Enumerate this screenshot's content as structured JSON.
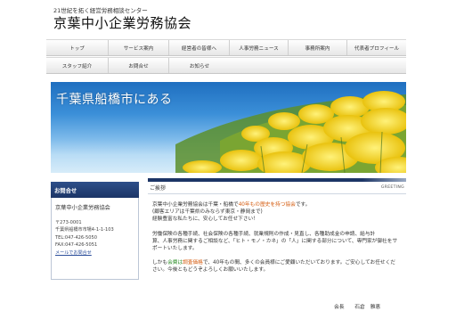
{
  "header": {
    "tagline": "21世紀を拓く経営労務相談センター",
    "title": "京葉中小企業労務協会"
  },
  "nav": {
    "row1": [
      {
        "label": "トップ"
      },
      {
        "label": "サービス案内"
      },
      {
        "label": "経営者の皆様へ"
      },
      {
        "label": "人事労務ニュース"
      },
      {
        "label": "事務所案内"
      },
      {
        "label": "代表者プロフィール"
      }
    ],
    "row2": [
      {
        "label": "スタッフ紹介"
      },
      {
        "label": "お問合せ"
      },
      {
        "label": "お知らせ"
      }
    ]
  },
  "hero": {
    "text": "千葉県船橋市にある"
  },
  "sidebar": {
    "heading": "お問合せ",
    "org": "京葉中小企業労務協会",
    "postal": "〒273-0001",
    "address": "千葉県船橋市市場4-1-1-103",
    "tel": "TEL:047-426-5050",
    "fax": "FAX:047-426-5051",
    "mail_link": "メールでお問合せ"
  },
  "main": {
    "title": "ご挨拶",
    "label": "GREETING",
    "p1_a": "京葉中小企業労務協会は千葉・船橋で",
    "p1_highlight": "40年もの歴史を持つ協会",
    "p1_b": "です。",
    "p1_line2": "(顧客エリアは千葉県のみならず東京・静岡まで)",
    "p1_line3": "経験豊富な私たちに、安心してお任せ下さい！",
    "p2_line1": "労働保険の各種手続、社会保険の各種手続、就業規則の作成・見直し、各種助成金の申請、給与計",
    "p2_line2": "算、人事労務に関するご相談など、「ヒト・モノ・カネ」の「人」に関する部分について、専門家が御社をサ",
    "p2_line3": "ポートいたします。",
    "p3_a": "しかも",
    "p3_highlight1": "会費は",
    "p3_highlight2": "調査価格",
    "p3_b": "で、40年もの間、多くの会員様にご愛顧いただいております。ご安心してお任せくだ",
    "p3_line2": "さい。今後ともどうぞよろしくお願いいたします。",
    "sign": "会長　　石倉　雅恵"
  },
  "colors": {
    "nav_bg": "#eeeeee",
    "sidebar_head": "#1c3566",
    "accent_orange": "#d45a0d",
    "accent_green": "#2f8f2a",
    "sky": "#3b8fd8",
    "flowers": "#f3d21b"
  }
}
